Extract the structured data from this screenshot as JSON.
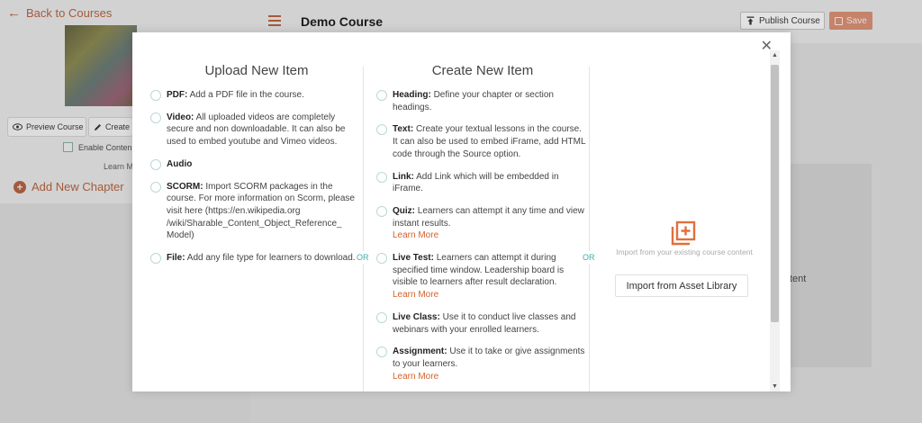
{
  "sidebar": {
    "back_label": "Back to Courses",
    "preview_label": "Preview Course",
    "create_label": "Create",
    "enable_label": "Enable Conten",
    "learn_label": "Learn M",
    "add_chapter_label": "Add New Chapter"
  },
  "header": {
    "course_title": "Demo Course",
    "publish_label": "Publish Course",
    "save_label": "Save"
  },
  "background": {
    "content_fragment": "tent"
  },
  "modal": {
    "upload": {
      "title": "Upload New Item",
      "items": [
        {
          "label": "PDF:",
          "desc": "Add a PDF file in the course."
        },
        {
          "label": "Video:",
          "desc": "All uploaded videos are completely secure and non downloadable. It can also be used to embed youtube and Vimeo videos."
        },
        {
          "label": "Audio",
          "desc": ""
        },
        {
          "label": "SCORM:",
          "desc": "Import SCORM packages in the course. For more information on Scorm, please visit here (https://en.wikipedia.org /wiki/Sharable_Content_Object_Reference_ Model)"
        },
        {
          "label": "File:",
          "desc": "Add any file type for learners to download."
        }
      ]
    },
    "create": {
      "title": "Create New Item",
      "items": [
        {
          "label": "Heading:",
          "desc": "Define your chapter or section headings.",
          "learn_more": ""
        },
        {
          "label": "Text:",
          "desc": "Create your textual lessons in the course. It can also be used to embed iFrame, add HTML code through the Source option.",
          "learn_more": ""
        },
        {
          "label": "Link:",
          "desc": "Add Link which will be embedded in iFrame.",
          "learn_more": ""
        },
        {
          "label": "Quiz:",
          "desc": "Learners can attempt it any time and view instant results.",
          "learn_more": "Learn More"
        },
        {
          "label": "Live Test:",
          "desc": "Learners can attempt it during specified time window. Leadership board is visible to learners after result declaration.",
          "learn_more": "Learn More"
        },
        {
          "label": "Live Class:",
          "desc": "Use it to conduct live classes and webinars with your enrolled learners.",
          "learn_more": ""
        },
        {
          "label": "Assignment:",
          "desc": "Use it to take or give assignments to your learners.",
          "learn_more": "Learn More"
        }
      ]
    },
    "or_label": "OR",
    "import": {
      "subtitle": "Import from your existing course content",
      "button_label": "Import from Asset Library"
    },
    "colors": {
      "accent": "#d3622c",
      "teal": "#3aaeaa"
    }
  }
}
